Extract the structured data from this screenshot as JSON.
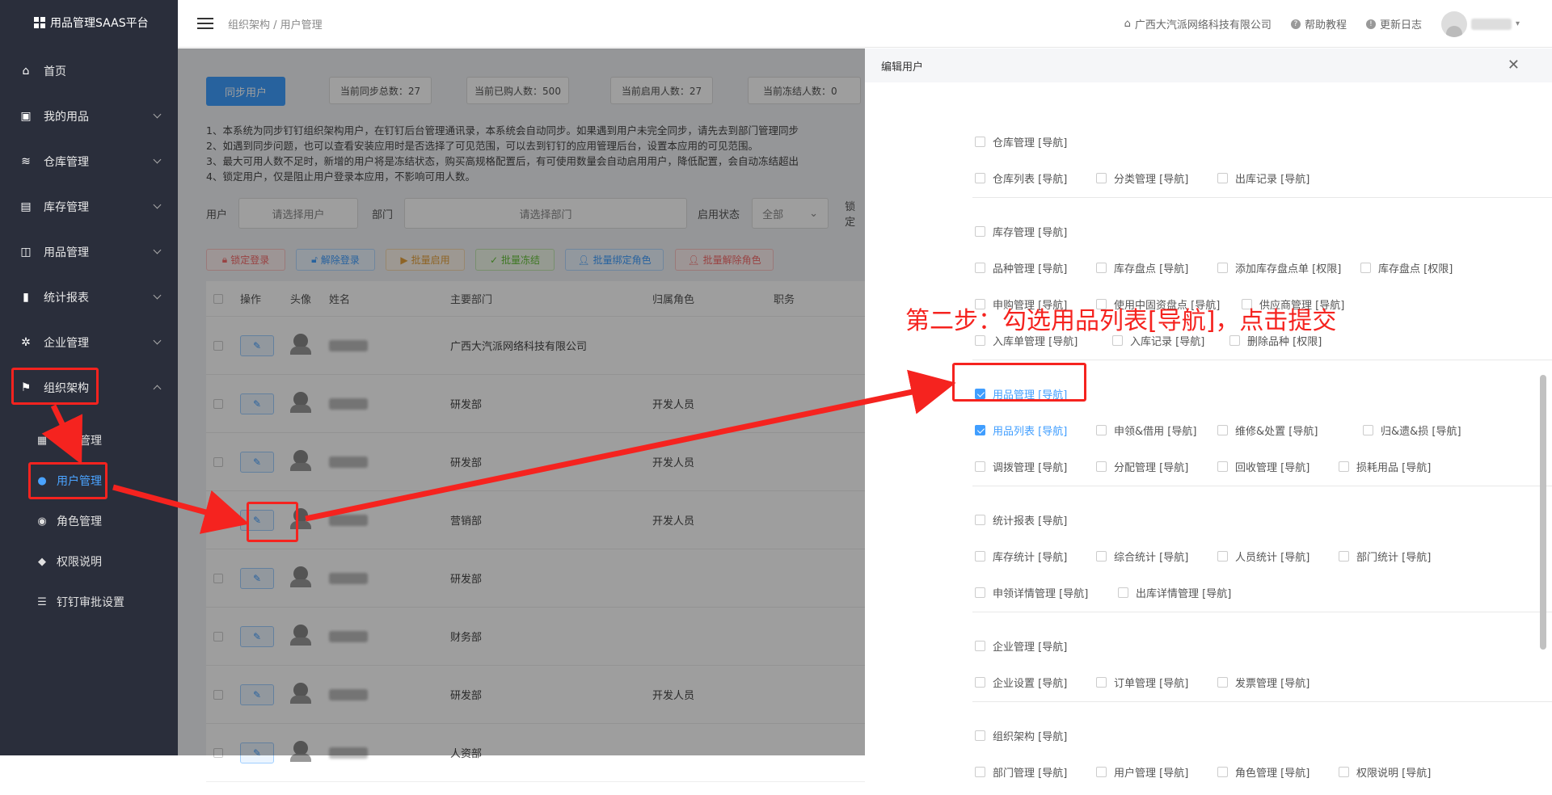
{
  "app": {
    "title": "用品管理SAAS平台"
  },
  "sidebar": {
    "items": [
      {
        "label": "首页",
        "icon": "home-icon",
        "glyph": "⌂"
      },
      {
        "label": "我的用品",
        "icon": "bag-icon",
        "glyph": "▣"
      },
      {
        "label": "仓库管理",
        "icon": "database-icon",
        "glyph": "≋"
      },
      {
        "label": "库存管理",
        "icon": "box-icon",
        "glyph": "▤"
      },
      {
        "label": "用品管理",
        "icon": "inbox-icon",
        "glyph": "◫"
      },
      {
        "label": "统计报表",
        "icon": "bar-chart-icon",
        "glyph": "▮"
      },
      {
        "label": "企业管理",
        "icon": "gear-icon",
        "glyph": "✲"
      },
      {
        "label": "组织架构",
        "icon": "flag-icon",
        "glyph": "⚑"
      }
    ],
    "sub_items": [
      {
        "label": "部门管理",
        "icon": "grid-icon",
        "glyph": "▦"
      },
      {
        "label": "用户管理",
        "icon": "user-icon",
        "glyph": "●"
      },
      {
        "label": "角色管理",
        "icon": "user-outline-icon",
        "glyph": "◉"
      },
      {
        "label": "权限说明",
        "icon": "shield-icon",
        "glyph": "◆"
      },
      {
        "label": "钉钉审批设置",
        "icon": "sliders-icon",
        "glyph": "☰"
      }
    ]
  },
  "topbar": {
    "breadcrumb": "组织架构 / 用户管理",
    "company": "广西大汽派网络科技有限公司",
    "help": "帮助教程",
    "changelog": "更新日志"
  },
  "main": {
    "sync_button": "同步用户",
    "stats": [
      "当前同步总数：27",
      "当前已购人数：500",
      "当前启用人数：27",
      "当前冻结人数：0"
    ],
    "notes": [
      "1、本系统为同步钉钉组织架构用户，在钉钉后台管理通讯录，本系统会自动同步。如果遇到用户未完全同步，请先去到部门管理同步",
      "2、如遇到同步问题，也可以查看安装应用时是否选择了可见范围，可以去到钉钉的应用管理后台，设置本应用的可见范围。",
      "3、最大可用人数不足时，新增的用户将是冻结状态，购买高规格配置后，有可使用数量会自动启用用户，降低配置，会自动冻结超出",
      "4、锁定用户，仅是阻止用户登录本应用，不影响可用人数。"
    ],
    "filters": {
      "user_label": "用户",
      "user_placeholder": "请选择用户",
      "dept_label": "部门",
      "dept_placeholder": "请选择部门",
      "status_label": "启用状态",
      "status_value": "全部",
      "lock_label": "锁定"
    },
    "actions": [
      "锁定登录",
      "解除登录",
      "批量启用",
      "批量冻结",
      "批量绑定角色",
      "批量解除角色"
    ],
    "table": {
      "headers": [
        "操作",
        "头像",
        "姓名",
        "主要部门",
        "归属角色",
        "职务"
      ],
      "rows": [
        {
          "dept": "广西大汽派网络科技有限公司",
          "role": ""
        },
        {
          "dept": "研发部",
          "role": "开发人员"
        },
        {
          "dept": "研发部",
          "role": "开发人员"
        },
        {
          "dept": "营销部",
          "role": "开发人员"
        },
        {
          "dept": "研发部",
          "role": ""
        },
        {
          "dept": "财务部",
          "role": ""
        },
        {
          "dept": "研发部",
          "role": "开发人员"
        },
        {
          "dept": "人资部",
          "role": ""
        }
      ]
    }
  },
  "panel": {
    "title": "编辑用户",
    "groups": [
      {
        "rows": [
          [
            "仓库管理 [导航]"
          ],
          [
            "仓库列表 [导航]",
            "分类管理 [导航]",
            "出库记录 [导航]"
          ]
        ]
      },
      {
        "rows": [
          [
            "库存管理 [导航]"
          ],
          [
            "品种管理 [导航]",
            "库存盘点 [导航]",
            "添加库存盘点单 [权限]",
            "库存盘点 [权限]"
          ],
          [
            "申购管理 [导航]",
            "使用中固资盘点 [导航]",
            "供应商管理 [导航]"
          ],
          [
            "入库单管理 [导航]",
            "入库记录 [导航]",
            "删除品种 [权限]"
          ]
        ]
      },
      {
        "rows": [
          [
            "用品管理 [导航]"
          ],
          [
            "用品列表 [导航]",
            "申领&借用 [导航]",
            "维修&处置 [导航]",
            "归&遗&损 [导航]"
          ],
          [
            "调拨管理 [导航]",
            "分配管理 [导航]",
            "回收管理 [导航]",
            "损耗用品 [导航]"
          ]
        ]
      },
      {
        "rows": [
          [
            "统计报表 [导航]"
          ],
          [
            "库存统计 [导航]",
            "综合统计 [导航]",
            "人员统计 [导航]",
            "部门统计 [导航]"
          ],
          [
            "申领详情管理 [导航]",
            "出库详情管理 [导航]"
          ]
        ]
      },
      {
        "rows": [
          [
            "企业管理 [导航]"
          ],
          [
            "企业设置 [导航]",
            "订单管理 [导航]",
            "发票管理 [导航]"
          ]
        ]
      },
      {
        "rows": [
          [
            "组织架构 [导航]"
          ],
          [
            "部门管理 [导航]",
            "用户管理 [导航]",
            "角色管理 [导航]",
            "权限说明 [导航]"
          ]
        ]
      }
    ],
    "checked": [
      "用品管理 [导航]",
      "用品列表 [导航]"
    ]
  },
  "annotation": {
    "text": "第二步：勾选用品列表[导航]，点击提交",
    "color": "#f5231f"
  }
}
